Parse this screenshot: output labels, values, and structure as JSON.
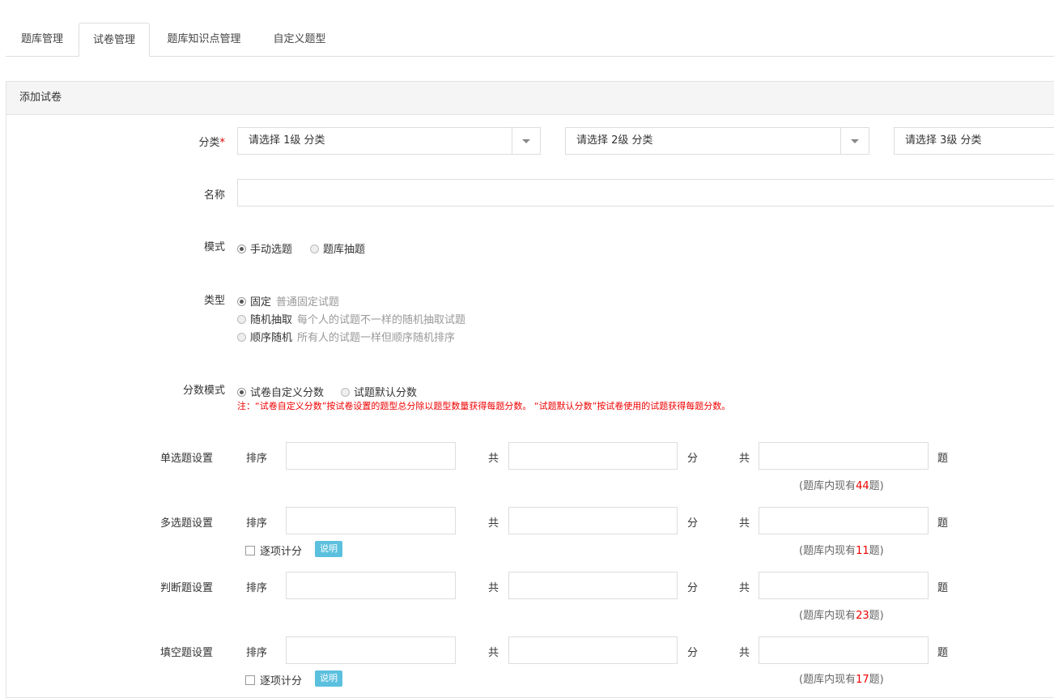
{
  "tabs": [
    {
      "label": "题库管理"
    },
    {
      "label": "试卷管理"
    },
    {
      "label": "题库知识点管理"
    },
    {
      "label": "自定义题型"
    }
  ],
  "panel": {
    "title": "添加试卷"
  },
  "form": {
    "category_label": "分类",
    "category_required": "*",
    "category_selects": [
      {
        "value": "请选择 1级 分类"
      },
      {
        "value": "请选择 2级 分类"
      },
      {
        "value": "请选择 3级 分类"
      }
    ],
    "name_label": "名称",
    "mode_label": "模式",
    "mode_options": [
      {
        "label": "手动选题",
        "selected": true
      },
      {
        "label": "题库抽题",
        "selected": false
      }
    ],
    "type_label": "类型",
    "type_options": [
      {
        "label": "固定",
        "desc": "普通固定试题",
        "selected": true
      },
      {
        "label": "随机抽取",
        "desc": "每个人的试题不一样的随机抽取试题",
        "selected": false
      },
      {
        "label": "顺序随机",
        "desc": "所有人的试题一样但顺序随机排序",
        "selected": false
      }
    ],
    "score_label": "分数模式",
    "score_options": [
      {
        "label": "试卷自定义分数",
        "selected": true
      },
      {
        "label": "试题默认分数",
        "selected": false
      }
    ],
    "score_note": "注：“试卷自定义分数”按试卷设置的题型总分除以题型数量获得每题分数。 “试题默认分数”按试卷使用的试题获得每题分数。"
  },
  "settings_common": {
    "order_label": "排序",
    "total_label": "共",
    "points_unit": "分",
    "count_prefix": "共",
    "count_unit": "题",
    "bank_prefix": "(题库内现有",
    "bank_suffix": "题)",
    "per_item_label": "逐项计分",
    "explain_label": "说明"
  },
  "settings": [
    {
      "label": "单选题设置",
      "bank_count": "44",
      "per_item": false
    },
    {
      "label": "多选题设置",
      "bank_count": "11",
      "per_item": true
    },
    {
      "label": "判断题设置",
      "bank_count": "23",
      "per_item": false
    },
    {
      "label": "填空题设置",
      "bank_count": "17",
      "per_item": true
    }
  ]
}
